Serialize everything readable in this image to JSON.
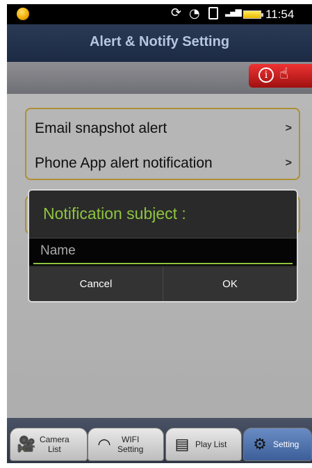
{
  "status_bar": {
    "time": "11:54"
  },
  "header": {
    "title": "Alert & Notify Setting"
  },
  "help_button": {
    "info_glyph": "i"
  },
  "menu": {
    "items": [
      {
        "label": "Email snapshot alert",
        "arrow": ">"
      },
      {
        "label": "Phone App alert notification",
        "arrow": ">"
      }
    ]
  },
  "dialog": {
    "title": "Notification subject :",
    "input_placeholder": "Name",
    "cancel_label": "Cancel",
    "ok_label": "OK"
  },
  "bottom_nav": {
    "tabs": [
      {
        "label_line1": "Camera",
        "label_line2": "List",
        "icon": "camera-icon"
      },
      {
        "label_line1": "WIFI",
        "label_line2": "Setting",
        "icon": "wifi-icon"
      },
      {
        "label_line1": "Play List",
        "label_line2": "",
        "icon": "sd-card-icon"
      },
      {
        "label_line1": "Setting",
        "label_line2": "",
        "icon": "gear-icon"
      }
    ]
  },
  "colors": {
    "accent_green": "#8ec53f",
    "header_blue": "#1c2a44",
    "border_gold": "#c7a33c"
  }
}
